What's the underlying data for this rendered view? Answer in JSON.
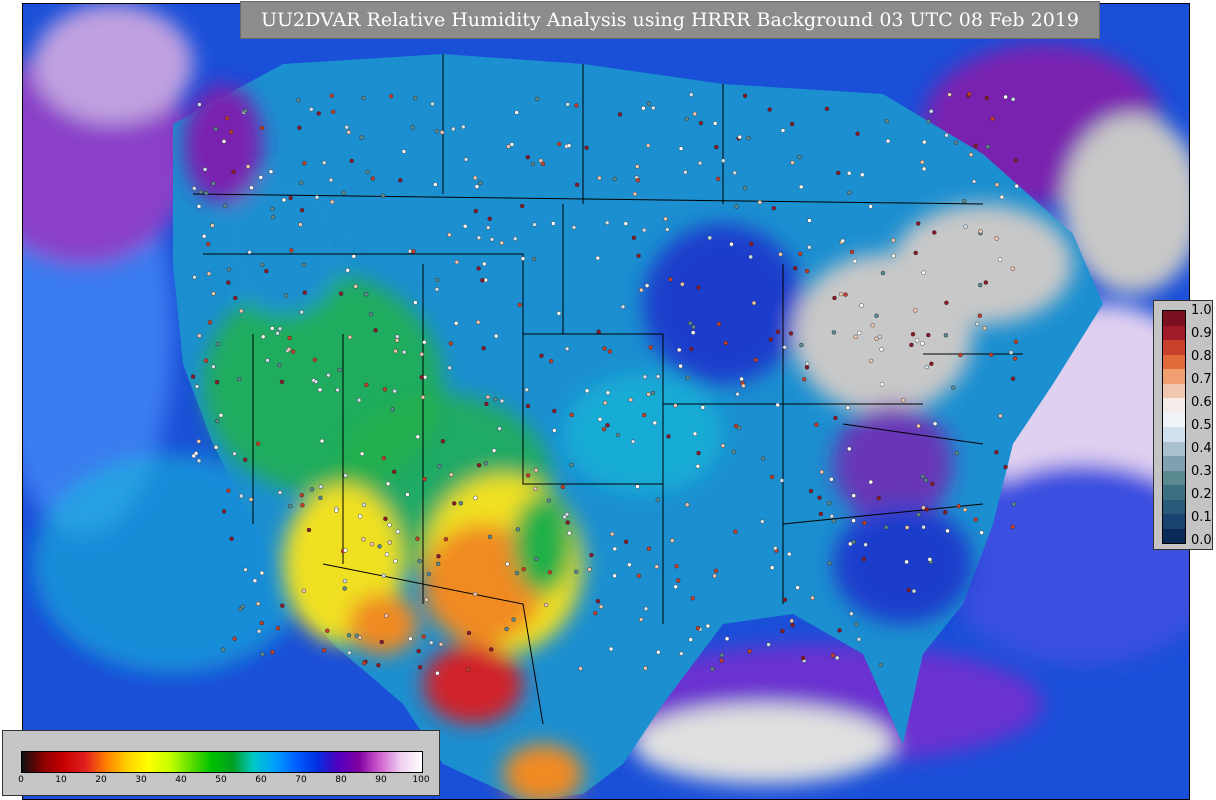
{
  "title": "UU2DVAR Relative Humidity Analysis using HRRR Background 03 UTC 08 Feb 2019",
  "legend_obs": {
    "labels": [
      "1.0",
      "0.9",
      "0.8",
      "0.7",
      "0.6",
      "0.5",
      "0.4",
      "0.3",
      "0.2",
      "0.1",
      "0.0"
    ],
    "colors": [
      "#7a1020",
      "#a01a2a",
      "#c8402a",
      "#e06a3a",
      "#f0a070",
      "#f0c8b0",
      "#f4ece8",
      "#f0f4f8",
      "#d0e0ec",
      "#a8c0d0",
      "#7ea0b0",
      "#5a8a90",
      "#3a7080",
      "#2a5a7a",
      "#1a4270",
      "#0a2a5a"
    ]
  },
  "colorbar": {
    "ticks": [
      "0",
      "10",
      "20",
      "30",
      "40",
      "50",
      "60",
      "70",
      "80",
      "90",
      "100"
    ],
    "colors": [
      "#101010",
      "#8b0000",
      "#c80000",
      "#e02020",
      "#ff8000",
      "#ffd000",
      "#ffff00",
      "#c8ff00",
      "#60e000",
      "#00c000",
      "#00a020",
      "#00c8c8",
      "#00a0ff",
      "#0060ff",
      "#0030e0",
      "#5000c0",
      "#8000a0",
      "#d060d0",
      "#f0d0f0",
      "#ffffff"
    ]
  },
  "map": {
    "colors": {
      "ocean": "#1a4fd8",
      "ocean_light": "#3a7cf0",
      "moist": "#1c3ccc",
      "saturated": "#c8c8c8",
      "very_moist": "#7a20b0",
      "mid": "#1c8fd0",
      "dry_green": "#22b04a",
      "dry_yellow": "#f0e020",
      "dry_orange": "#f08a20",
      "dry_red": "#d0202a",
      "cyan": "#18c0d8"
    }
  }
}
